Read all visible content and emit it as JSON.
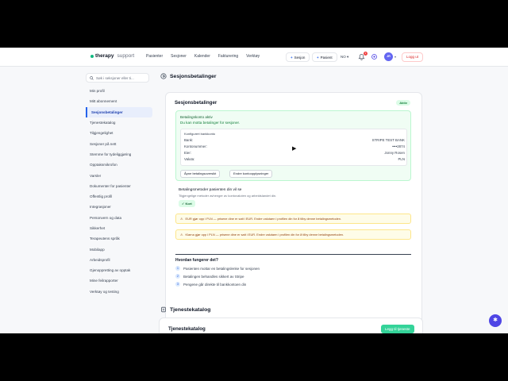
{
  "brand": {
    "name": "therapy",
    "sub": "support"
  },
  "nav": [
    "Pasienter",
    "Sesjoner",
    "Kalender",
    "Fakturering",
    "Verktøy"
  ],
  "header": {
    "new_session": "Sesjon",
    "new_patient": "Pasient",
    "lang": "NO",
    "notif_count": "1",
    "avatar": "JR",
    "logout": "Logg ut"
  },
  "search": {
    "placeholder": "Søk i seksjoner eller ti..."
  },
  "sidebar": [
    "Min profil",
    "Mitt abonnement",
    "Sesjonsbetalinger",
    "Tjenestekatalog",
    "Tilgjengelighet",
    "Sesjoner på nett",
    "Stemme for tydeliggjøring",
    "Opptaksmikrofon",
    "Varsler",
    "Dokumenter for pasienter",
    "Offentlig profil",
    "Integrasjoner",
    "Personvern og data",
    "Sikkerhet",
    "Terapeutens språk",
    "Mobilapp",
    "Arbeidsprofil",
    "Gjenoppretting av opptak",
    "Mine feilrapporter",
    "Verktøy og testing"
  ],
  "page_title": "Sesjonsbetalinger",
  "card": {
    "title": "Sesjonsbetalinger",
    "status": "Aktiv",
    "account_active": "Betalingskonto aktiv",
    "account_sub": "Du kan motta betalinger for sesjoner.",
    "configured": "Konfigurert bankkonto",
    "rows": [
      {
        "label": "Bank:",
        "value": "STRIPE TEST BANK"
      },
      {
        "label": "Kontonummer:",
        "value": "••••2874"
      },
      {
        "label": "Eier:",
        "value": "Jonny Rosen"
      },
      {
        "label": "Valuta:",
        "value": "PLN"
      }
    ],
    "btn_dashboard": "Åpne betalingsoversikt",
    "btn_edit": "Endre kontoopplysninger",
    "methods_title": "Betalingsmetoder pasienten din vil se",
    "methods_sub": "Tilgjengelige metoder avhenger av kontovaluten og arbeidslandet din.",
    "kort": "Kort",
    "warn1": "EUR gjør opp i PLN — prisene dine er satt i EUR. Endre valutaen i profilen din for å tilby denne betalingsmetoden.",
    "warn2": "Klarna gjør opp i PLN — prisene dine er satt i EUR. Endre valutaen i profilen din for å tilby denne betalingsmetoden.",
    "how_title": "Hvordan fungerer det?",
    "steps": [
      "Pasienten mottar en betalingslenke for sesjonen",
      "Betalingen behandles sikkert av Stripe",
      "Pengene går direkte til bankkontoen din"
    ]
  },
  "catalog": {
    "section": "Tjenestekatalog",
    "title": "Tjenestekatalog",
    "add": "Legg til tjeneste"
  }
}
